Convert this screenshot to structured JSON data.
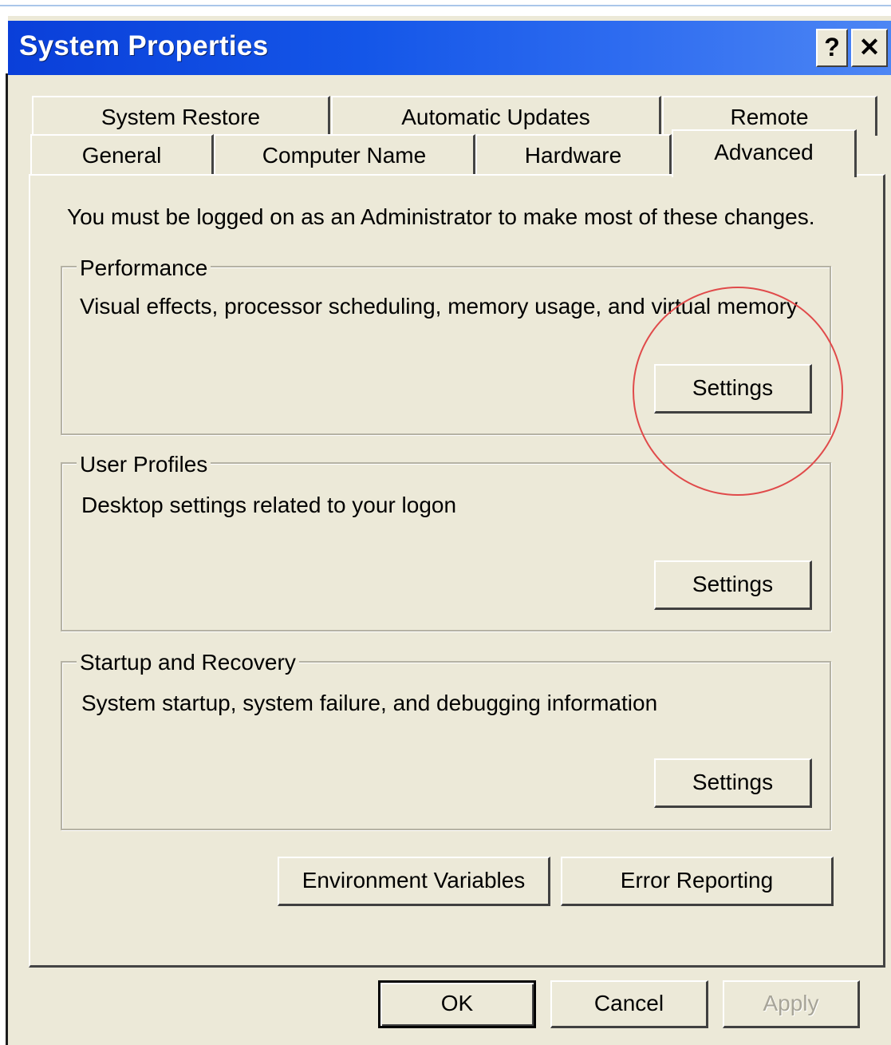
{
  "window": {
    "title": "System Properties",
    "help_label": "?",
    "close_label": "✕"
  },
  "tabs_row1": [
    {
      "label": "System Restore"
    },
    {
      "label": "Automatic Updates"
    },
    {
      "label": "Remote"
    }
  ],
  "tabs_row2": [
    {
      "label": "General"
    },
    {
      "label": "Computer Name"
    },
    {
      "label": "Hardware"
    },
    {
      "label": "Advanced",
      "selected": true
    }
  ],
  "advanced": {
    "admin_note": "You must be logged on as an Administrator to make most of these changes.",
    "performance": {
      "title": "Performance",
      "description": "Visual effects, processor scheduling, memory usage, and virtual memory",
      "button_label": "Settings"
    },
    "user_profiles": {
      "title": "User Profiles",
      "description": "Desktop settings related to your logon",
      "button_label": "Settings"
    },
    "startup_recovery": {
      "title": "Startup and Recovery",
      "description": "System startup, system failure, and debugging information",
      "button_label": "Settings"
    },
    "env_vars_label": "Environment Variables",
    "error_reporting_label": "Error Reporting"
  },
  "footer_buttons": {
    "ok_label": "OK",
    "cancel_label": "Cancel",
    "apply_label": "Apply",
    "apply_disabled": true
  },
  "colors": {
    "titlebar": "#0a3fd9",
    "dialog_face": "#ece9d8",
    "highlight_circle": "#e04a4a"
  }
}
